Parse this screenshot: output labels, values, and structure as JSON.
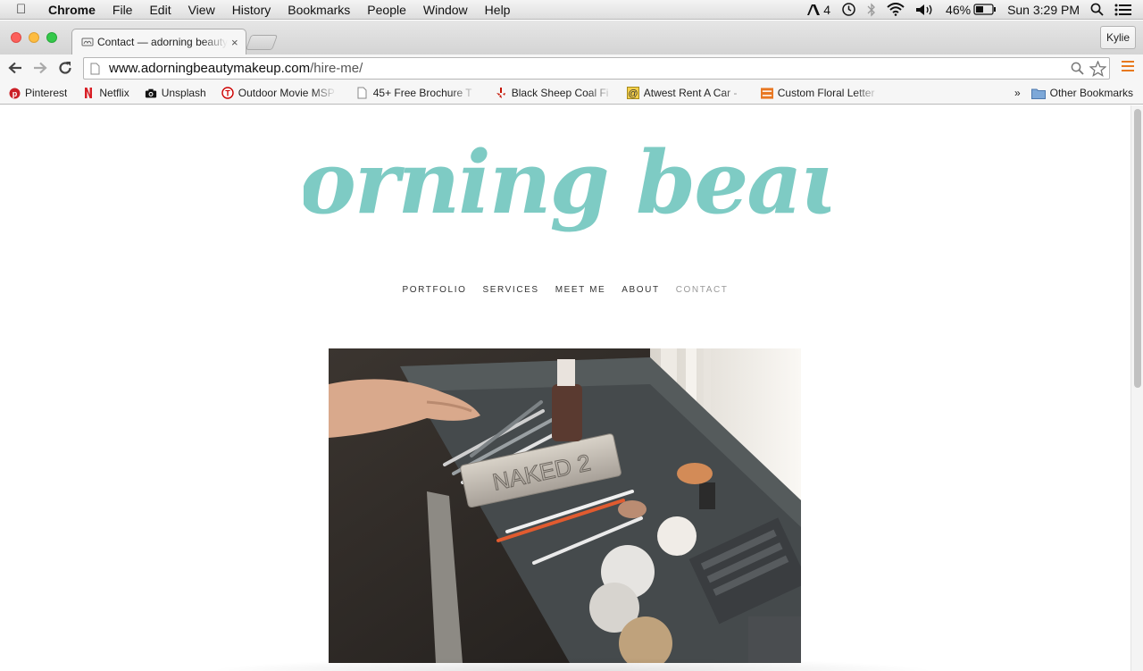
{
  "menubar": {
    "app": "Chrome",
    "items": [
      "File",
      "Edit",
      "View",
      "History",
      "Bookmarks",
      "People",
      "Window",
      "Help"
    ],
    "adobe_count": "4",
    "battery": "46%",
    "clock": "Sun 3:29 PM"
  },
  "tab": {
    "title": "Contact — adorning beauty",
    "close": "×"
  },
  "profile": {
    "name": "Kylie"
  },
  "omnibox": {
    "host": "www.adorningbeautymakeup.com",
    "path": "/hire-me/"
  },
  "bookmarks": {
    "items": [
      {
        "label": "Pinterest",
        "icon": "pinterest-icon"
      },
      {
        "label": "Netflix",
        "icon": "netflix-icon"
      },
      {
        "label": "Unsplash",
        "icon": "camera-icon"
      },
      {
        "label": "Outdoor Movie MSP",
        "icon": "target-icon"
      },
      {
        "label": "45+ Free Brochure T",
        "icon": "page-icon"
      },
      {
        "label": "Black Sheep Coal Fi",
        "icon": "yelp-icon"
      },
      {
        "label": "Atwest Rent A Car -",
        "icon": "at-icon"
      },
      {
        "label": "Custom Floral Letter",
        "icon": "etsy-icon"
      }
    ],
    "more": "»",
    "other": "Other Bookmarks"
  },
  "site": {
    "logo": "adorning beauty",
    "nav": [
      "PORTFOLIO",
      "SERVICES",
      "MEET ME",
      "ABOUT",
      "CONTACT"
    ],
    "hero_palette_text": "NAKED 2"
  },
  "colors": {
    "logo": "#7ecbc4",
    "nav_active": "#999999"
  }
}
